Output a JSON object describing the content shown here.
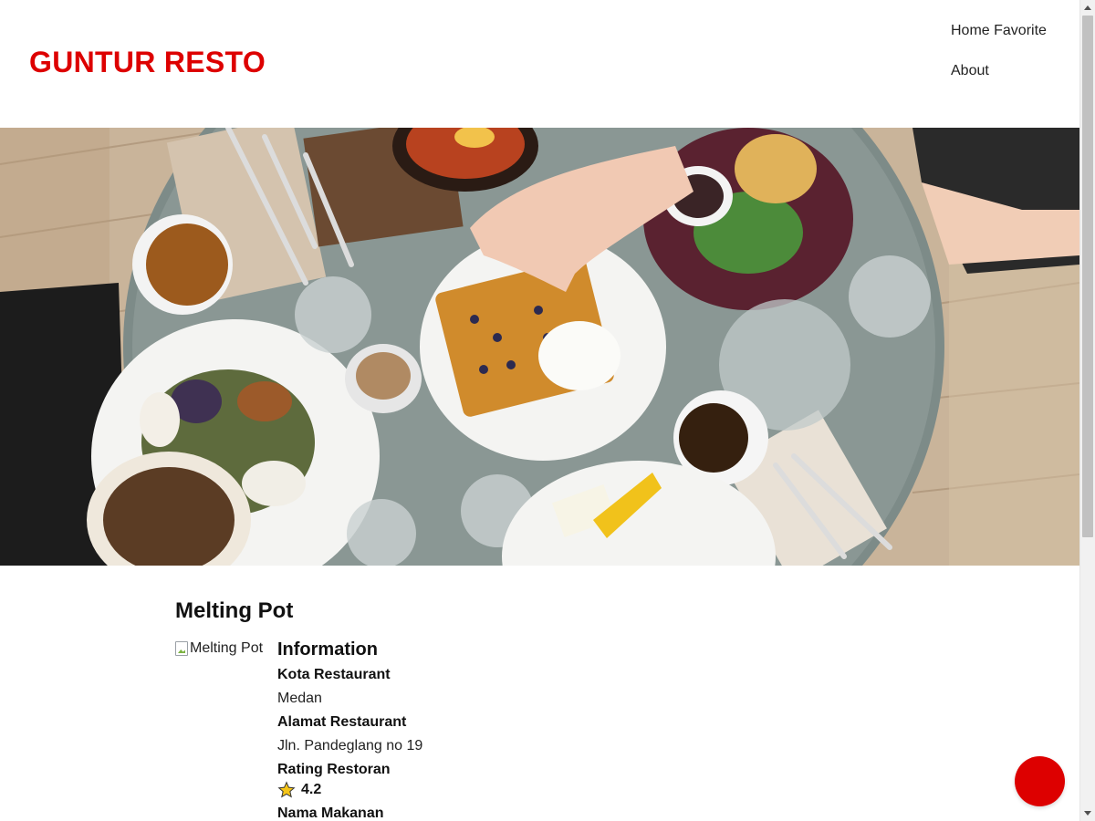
{
  "app": {
    "brand": "GUNTUR RESTO",
    "brand_color": "#dd0000"
  },
  "nav": {
    "items": [
      {
        "label": "Home Favorite"
      },
      {
        "label": "About"
      }
    ]
  },
  "hero": {
    "image_name": "restaurant-table-hero-image"
  },
  "restaurant": {
    "name": "Melting Pot",
    "image_alt": "Melting Pot",
    "information_heading": "Information",
    "city_label": "Kota Restaurant",
    "city": "Medan",
    "address_label": "Alamat Restaurant",
    "address": "Jln. Pandeglang no 19",
    "rating_label": "Rating Restoran",
    "rating": "4.2",
    "menu_label": "Nama Makanan"
  },
  "colors": {
    "accent": "#dd0000",
    "star": "#f5c518"
  },
  "icons": {
    "rating": "star-icon",
    "image_placeholder": "broken-image-icon",
    "fab": "favorite-button"
  }
}
